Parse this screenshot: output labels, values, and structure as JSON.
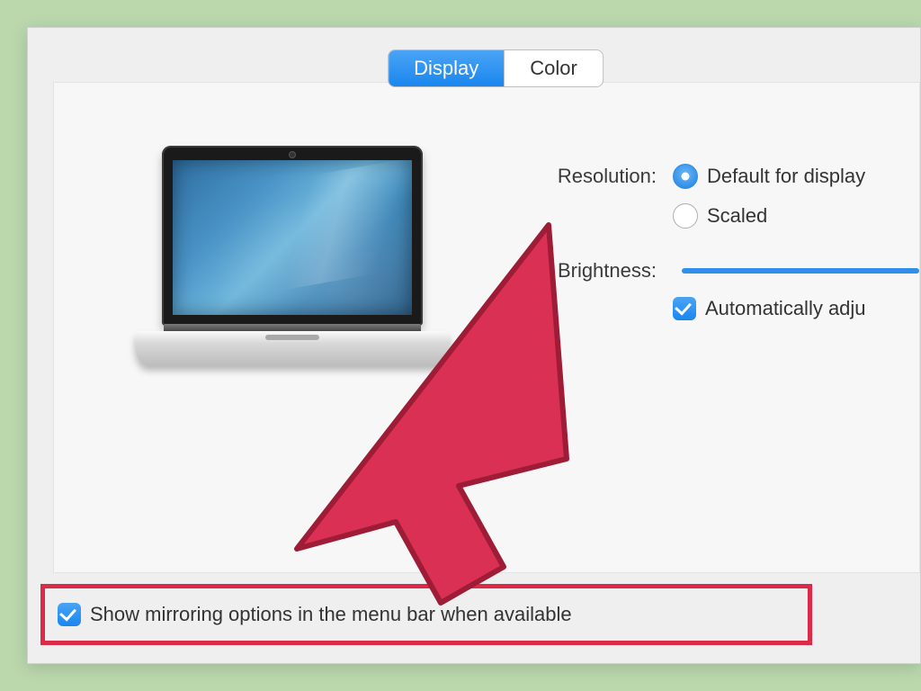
{
  "tabs": {
    "display": "Display",
    "color": "Color"
  },
  "resolution": {
    "label": "Resolution:",
    "option_default": "Default for display",
    "option_scaled": "Scaled"
  },
  "brightness": {
    "label": "Brightness:",
    "auto_label": "Automatically adju"
  },
  "mirroring": {
    "label": "Show mirroring options in the menu bar when available"
  }
}
